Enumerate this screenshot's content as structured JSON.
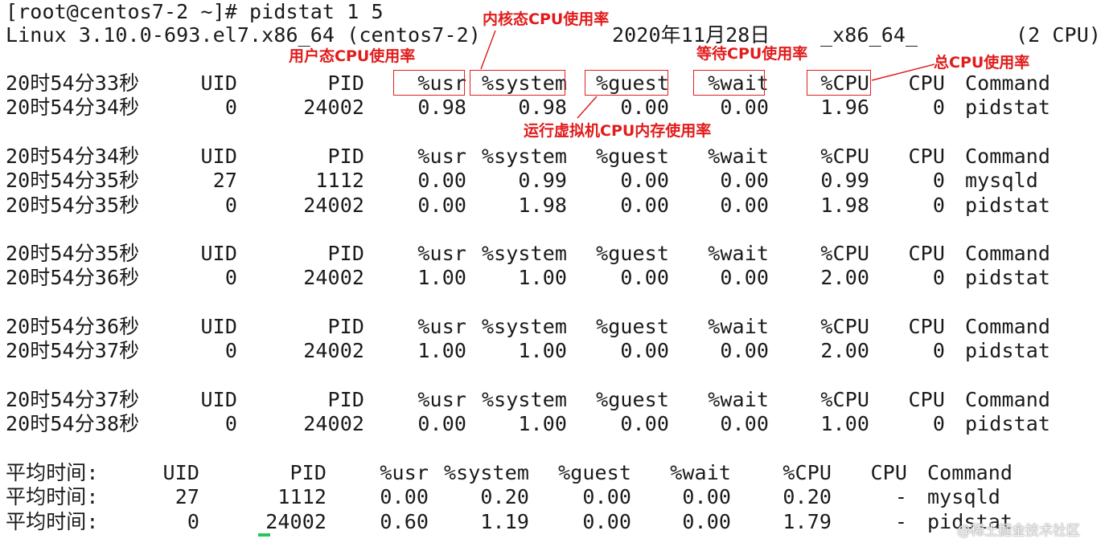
{
  "terminal": {
    "prompt_line": "[root@centos7-2 ~]# pidstat 1 5",
    "sys_info": {
      "kernel": "Linux 3.10.0-693.el7.x86_64 (centos7-2)",
      "date": "2020年11月28日",
      "arch": "_x86_64_",
      "cpus": "(2 CPU)"
    },
    "blocks": [
      {
        "header": [
          "20时54分33秒",
          "UID",
          "PID",
          "%usr",
          "%system",
          "%guest",
          "%wait",
          "%CPU",
          "CPU",
          "Command"
        ],
        "rows": [
          [
            "20时54分34秒",
            "0",
            "24002",
            "0.98",
            "0.98",
            "0.00",
            "0.00",
            "1.96",
            "0",
            "pidstat"
          ]
        ]
      },
      {
        "header": [
          "20时54分34秒",
          "UID",
          "PID",
          "%usr",
          "%system",
          "%guest",
          "%wait",
          "%CPU",
          "CPU",
          "Command"
        ],
        "rows": [
          [
            "20时54分35秒",
            "27",
            "1112",
            "0.00",
            "0.99",
            "0.00",
            "0.00",
            "0.99",
            "0",
            "mysqld"
          ],
          [
            "20时54分35秒",
            "0",
            "24002",
            "0.00",
            "1.98",
            "0.00",
            "0.00",
            "1.98",
            "0",
            "pidstat"
          ]
        ]
      },
      {
        "header": [
          "20时54分35秒",
          "UID",
          "PID",
          "%usr",
          "%system",
          "%guest",
          "%wait",
          "%CPU",
          "CPU",
          "Command"
        ],
        "rows": [
          [
            "20时54分36秒",
            "0",
            "24002",
            "1.00",
            "1.00",
            "0.00",
            "0.00",
            "2.00",
            "0",
            "pidstat"
          ]
        ]
      },
      {
        "header": [
          "20时54分36秒",
          "UID",
          "PID",
          "%usr",
          "%system",
          "%guest",
          "%wait",
          "%CPU",
          "CPU",
          "Command"
        ],
        "rows": [
          [
            "20时54分37秒",
            "0",
            "24002",
            "1.00",
            "1.00",
            "0.00",
            "0.00",
            "2.00",
            "0",
            "pidstat"
          ]
        ]
      },
      {
        "header": [
          "20时54分37秒",
          "UID",
          "PID",
          "%usr",
          "%system",
          "%guest",
          "%wait",
          "%CPU",
          "CPU",
          "Command"
        ],
        "rows": [
          [
            "20时54分38秒",
            "0",
            "24002",
            "0.00",
            "1.00",
            "0.00",
            "0.00",
            "1.00",
            "0",
            "pidstat"
          ]
        ]
      }
    ],
    "average": {
      "header": [
        "平均时间:",
        "UID",
        "PID",
        "%usr",
        "%system",
        "%guest",
        "%wait",
        "%CPU",
        "CPU",
        "Command"
      ],
      "rows": [
        [
          "平均时间:",
          "27",
          "1112",
          "0.00",
          "0.20",
          "0.00",
          "0.00",
          "0.20",
          "-",
          "mysqld"
        ],
        [
          "平均时间:",
          "0",
          "24002",
          "0.60",
          "1.19",
          "0.00",
          "0.00",
          "1.79",
          "-",
          "pidstat"
        ]
      ]
    }
  },
  "annotations": {
    "usr": "用户态CPU使用率",
    "system": "内核态CPU使用率",
    "guest": "运行虚拟机CPU内存使用率",
    "wait": "等待CPU使用率",
    "cpu": "总CPU使用率",
    "color": "#e21b1b"
  },
  "watermark": "@稀土掘金技术社区",
  "colors": {
    "background": "#ffffff",
    "text": "#1a1a1a",
    "cursor": "#22c55e"
  }
}
